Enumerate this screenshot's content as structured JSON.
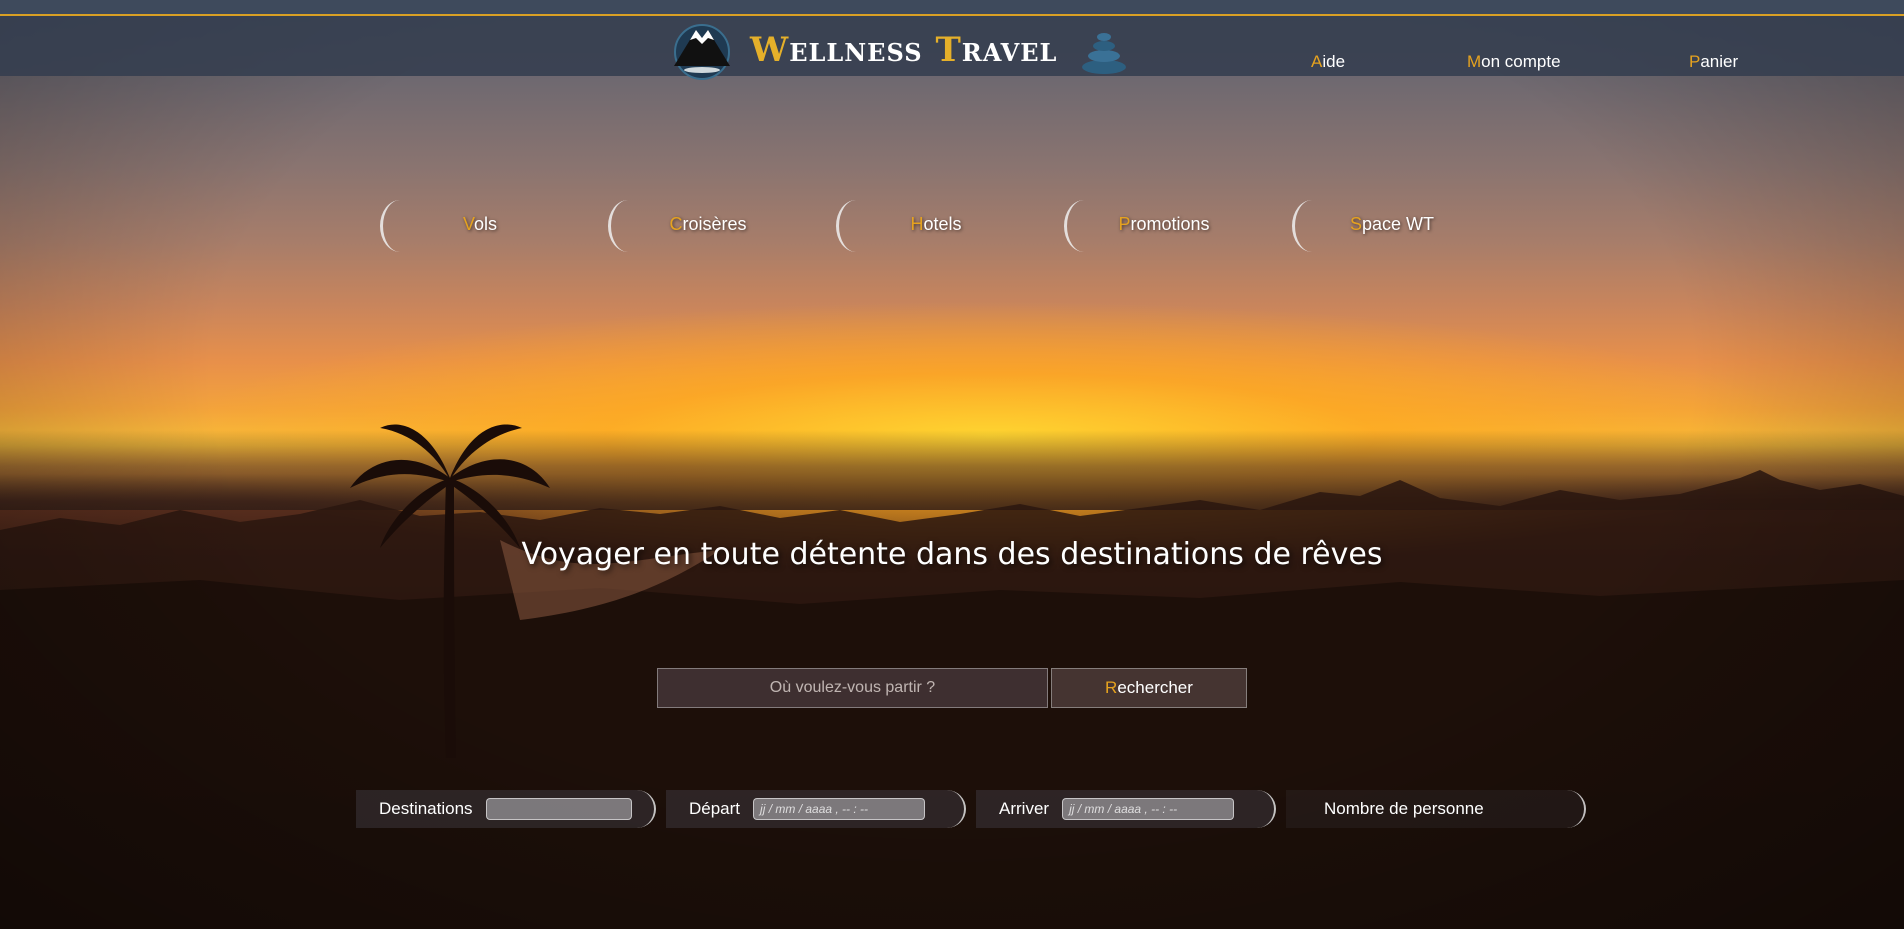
{
  "header": {
    "brand_first": "W",
    "brand_rest": "ellness",
    "brand2_first": "T",
    "brand2_rest": "ravel",
    "nav": [
      {
        "initial": "A",
        "rest": "ide"
      },
      {
        "initial": "M",
        "rest": "on compte"
      },
      {
        "initial": "P",
        "rest": "anier"
      }
    ]
  },
  "categories": [
    {
      "initial": "V",
      "rest": "ols"
    },
    {
      "initial": "C",
      "rest": "roisères"
    },
    {
      "initial": "H",
      "rest": "otels"
    },
    {
      "initial": "P",
      "rest": "romotions"
    },
    {
      "initial": "S",
      "rest": "pace WT"
    }
  ],
  "hero": {
    "headline": "Voyager en toute détente dans des destinations de rêves"
  },
  "search": {
    "placeholder": "Où voulez-vous partir ?",
    "button_initial": "R",
    "button_rest": "echercher"
  },
  "filters": {
    "destinations_label": "Destinations",
    "depart_label": "Départ",
    "depart_placeholder": "jj / mm / aaaa , -- : --",
    "arriver_label": "Arriver",
    "arriver_placeholder": "jj / mm / aaaa , -- : --",
    "persons_label": "Nombre de personne"
  },
  "colors": {
    "accent": "#e5a21f",
    "header_bg": "#343e4e"
  }
}
